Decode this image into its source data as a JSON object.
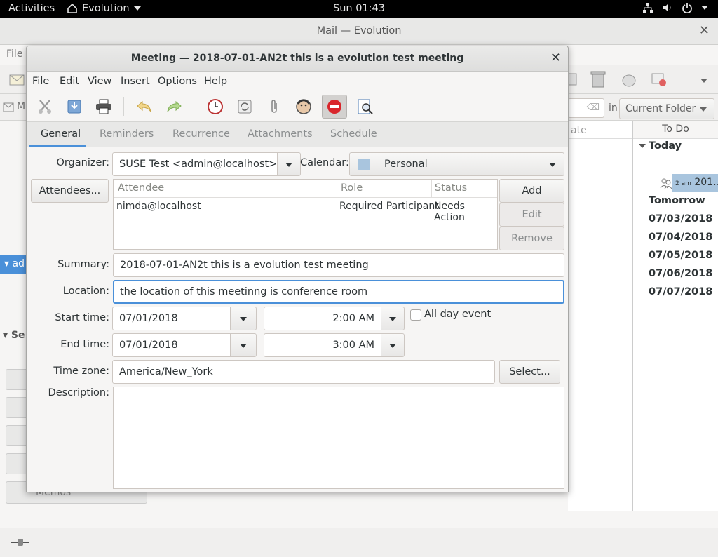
{
  "topbar": {
    "activities": "Activities",
    "app_name": "Evolution",
    "clock": "Sun 01:43",
    "icons": [
      "network-icon",
      "volume-icon",
      "power-icon"
    ]
  },
  "main_window": {
    "title": "Mail — Evolution",
    "menu_first": "File",
    "search_scope_prefix": "in",
    "search_scope": "Current Folder",
    "sidebar_selected": "ad",
    "sidebar_section": "Se",
    "memos_label": "Memos",
    "message_list_header": "ate",
    "todo": {
      "header": "To Do",
      "today": "Today",
      "appointment_time": "2 am",
      "appointment_text": "201…",
      "days": [
        "Tomorrow",
        "07/03/2018",
        "07/04/2018",
        "07/05/2018",
        "07/06/2018",
        "07/07/2018"
      ]
    }
  },
  "dialog": {
    "title": "Meeting — 2018-07-01-AN2t this is a evolution test meeting",
    "menu": [
      "File",
      "Edit",
      "View",
      "Insert",
      "Options",
      "Help"
    ],
    "toolbar_icons": [
      "cut-icon",
      "save-icon",
      "print-icon",
      "undo-icon",
      "redo-icon",
      "alarm-icon",
      "recurrence-icon",
      "attachment-icon",
      "freebusy-icon",
      "cancel-meeting-icon",
      "print-preview-icon"
    ],
    "tabs": [
      "General",
      "Reminders",
      "Recurrence",
      "Attachments",
      "Schedule"
    ],
    "active_tab": "General",
    "organizer_label": "Organizer:",
    "organizer_value": "SUSE Test <admin@localhost>",
    "calendar_label": "Calendar:",
    "calendar_value": "Personal",
    "calendar_color": "#a9c5de",
    "attendees_button": "Attendees...",
    "attendee_columns": [
      "Attendee",
      "Role",
      "Status"
    ],
    "attendees": [
      {
        "attendee": "nimda@localhost",
        "role": "Required Participant",
        "status": "Needs Action"
      }
    ],
    "add_button": "Add",
    "edit_button": "Edit",
    "remove_button": "Remove",
    "summary_label": "Summary:",
    "summary_value": "2018-07-01-AN2t this is a evolution test meeting",
    "location_label": "Location:",
    "location_value": "the location of this meetinng is conference room",
    "start_label": "Start time:",
    "start_date": "07/01/2018",
    "start_time": "2:00 AM",
    "all_day_label": "All day event",
    "end_label": "End time:",
    "end_date": "07/01/2018",
    "end_time": "3:00 AM",
    "timezone_label": "Time zone:",
    "timezone_value": "America/New_York",
    "select_button": "Select...",
    "description_label": "Description:"
  },
  "colors": {
    "accent": "#4a90d9",
    "cancel_red": "#d9262c"
  }
}
